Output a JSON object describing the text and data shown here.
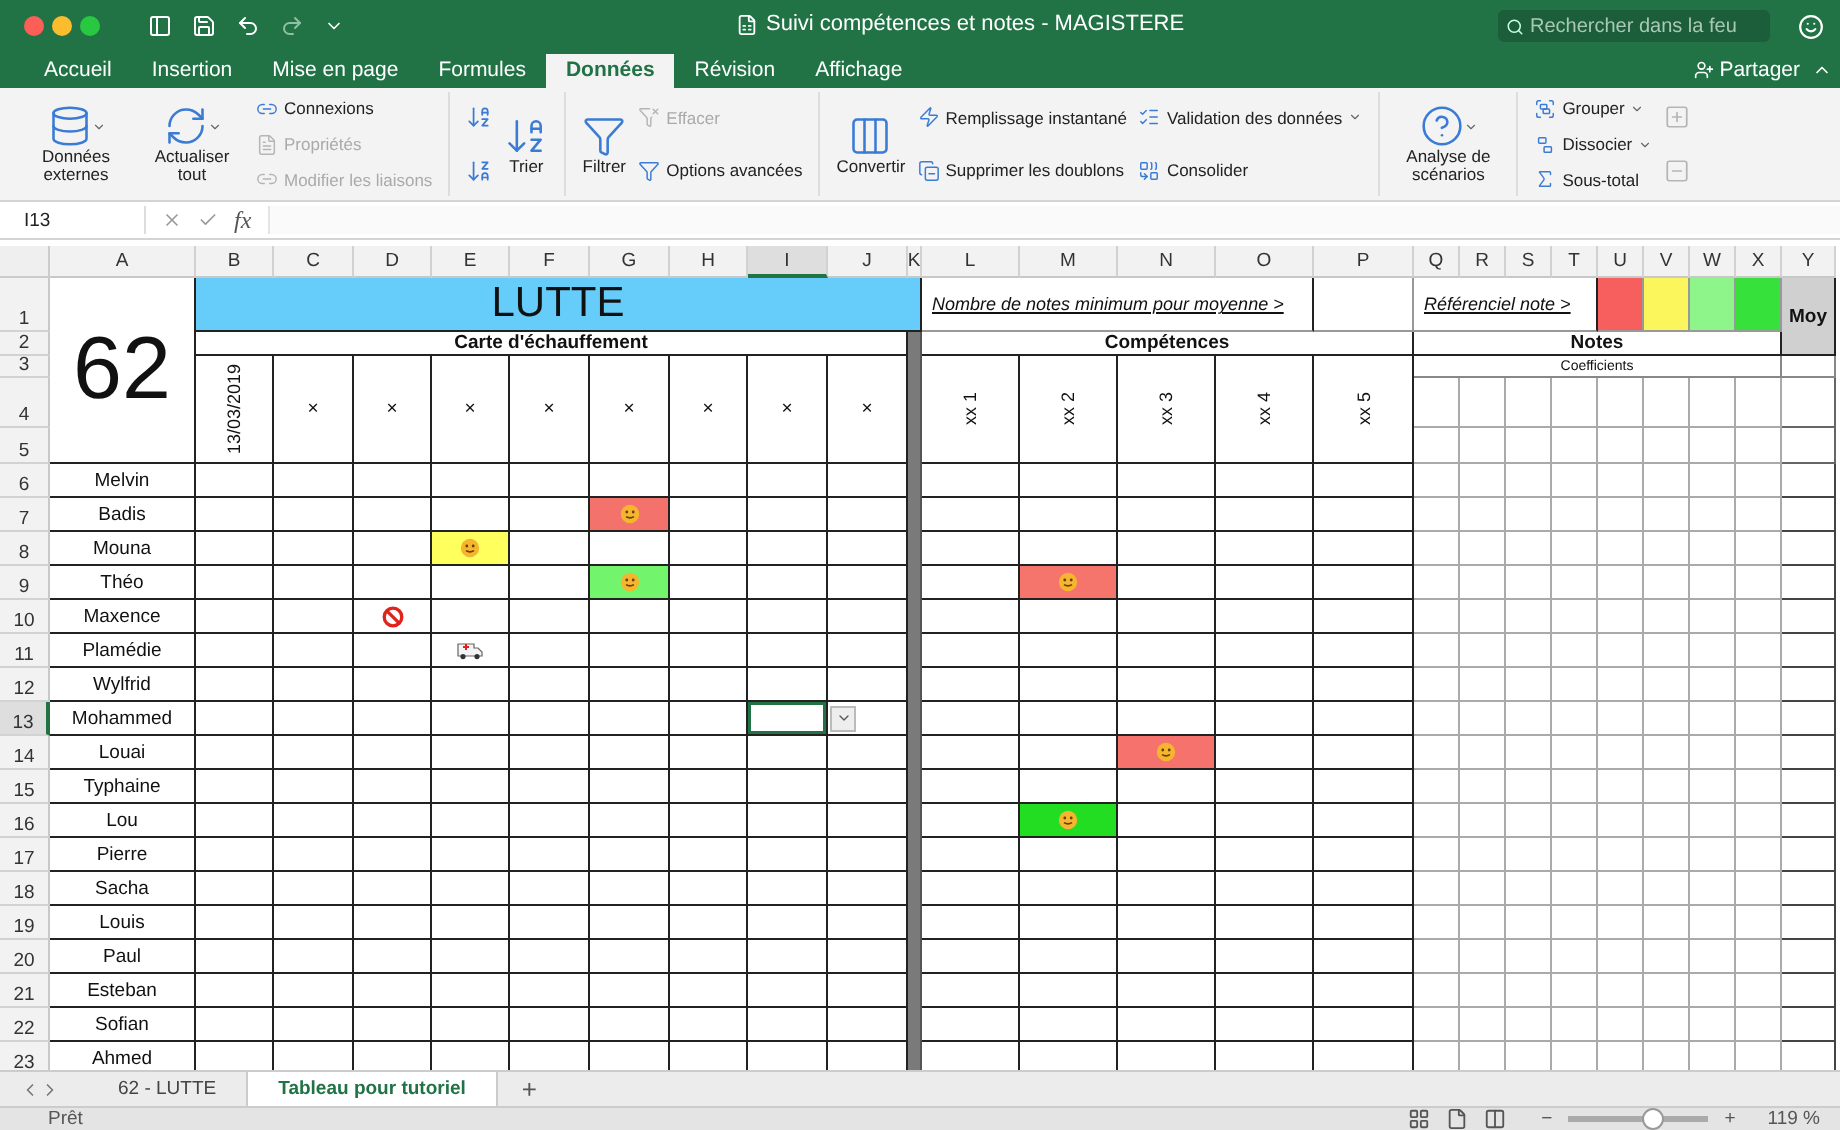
{
  "window": {
    "title": "Suivi compétences et notes - MAGISTERE",
    "search": {
      "placeholder": "Rechercher dans la feu"
    },
    "share": "Partager"
  },
  "tabs": [
    {
      "label": "Accueil",
      "selected": false
    },
    {
      "label": "Insertion",
      "selected": false
    },
    {
      "label": "Mise en page",
      "selected": false
    },
    {
      "label": "Formules",
      "selected": false
    },
    {
      "label": "Données",
      "selected": true
    },
    {
      "label": "Révision",
      "selected": false
    },
    {
      "label": "Affichage",
      "selected": false
    }
  ],
  "ribbon": [
    [
      [
        {
          "kind": "large",
          "label": "Données externes",
          "disabled": false,
          "dropdown": true
        }
      ],
      [
        {
          "kind": "large",
          "label": "Actualiser tout",
          "disabled": false,
          "dropdown": true
        }
      ],
      [
        {
          "kind": "small",
          "label": "Connexions",
          "disabled": false
        },
        {
          "kind": "small",
          "label": "Propriétés",
          "disabled": true
        },
        {
          "kind": "small",
          "label": "Modifier les liaisons",
          "disabled": true
        }
      ]
    ],
    [
      [
        {
          "kind": "icon",
          "disabled": false
        },
        {
          "kind": "icon",
          "disabled": false
        }
      ],
      [
        {
          "kind": "large",
          "label": "Trier",
          "disabled": false
        }
      ]
    ],
    [
      [
        {
          "kind": "large",
          "label": "Filtrer",
          "disabled": false
        }
      ],
      [
        {
          "kind": "small",
          "label": "Effacer",
          "disabled": true
        },
        {
          "kind": "small",
          "label": "Options avancées",
          "disabled": false
        }
      ]
    ],
    [
      [
        {
          "kind": "large",
          "label": "Convertir",
          "disabled": false
        }
      ],
      [
        {
          "kind": "small",
          "label": "Remplissage instantané",
          "disabled": false
        },
        {
          "kind": "small",
          "label": "Supprimer les doublons",
          "disabled": false
        }
      ],
      [
        {
          "kind": "small",
          "label": "Validation des données",
          "disabled": false,
          "dropdown": true
        },
        {
          "kind": "small",
          "label": "Consolider",
          "disabled": false
        }
      ]
    ],
    [
      [
        {
          "kind": "large",
          "label": "Analyse de scénarios",
          "disabled": false,
          "dropdown": true
        }
      ]
    ],
    [
      [
        {
          "kind": "small",
          "label": "Grouper",
          "disabled": false,
          "dropdown": true
        },
        {
          "kind": "small",
          "label": "Dissocier",
          "disabled": false,
          "dropdown": true
        },
        {
          "kind": "small",
          "label": "Sous-total",
          "disabled": false
        }
      ],
      [
        {
          "kind": "icon",
          "disabled": true
        },
        {
          "kind": "icon",
          "disabled": true
        }
      ]
    ]
  ],
  "formula_bar": {
    "cell": "I13",
    "fx": "fx"
  },
  "columns": [
    {
      "label": "A",
      "selected": false
    },
    {
      "label": "B",
      "selected": false
    },
    {
      "label": "C",
      "selected": false
    },
    {
      "label": "D",
      "selected": false
    },
    {
      "label": "E",
      "selected": false
    },
    {
      "label": "F",
      "selected": false
    },
    {
      "label": "G",
      "selected": false
    },
    {
      "label": "H",
      "selected": false
    },
    {
      "label": "I",
      "selected": true
    },
    {
      "label": "J",
      "selected": false
    },
    {
      "label": "K",
      "selected": false
    },
    {
      "label": "L",
      "selected": false
    },
    {
      "label": "M",
      "selected": false
    },
    {
      "label": "N",
      "selected": false
    },
    {
      "label": "O",
      "selected": false
    },
    {
      "label": "P",
      "selected": false
    },
    {
      "label": "Q",
      "selected": false
    },
    {
      "label": "R",
      "selected": false
    },
    {
      "label": "S",
      "selected": false
    },
    {
      "label": "T",
      "selected": false
    },
    {
      "label": "U",
      "selected": false
    },
    {
      "label": "V",
      "selected": false
    },
    {
      "label": "W",
      "selected": false
    },
    {
      "label": "X",
      "selected": false
    },
    {
      "label": "Y",
      "selected": false
    }
  ],
  "row_numbers": [
    {
      "label": "1",
      "selected": false
    },
    {
      "label": "2",
      "selected": false
    },
    {
      "label": "3",
      "selected": false
    },
    {
      "label": "4",
      "selected": false
    },
    {
      "label": "5",
      "selected": false
    },
    {
      "label": "6",
      "selected": false
    },
    {
      "label": "7",
      "selected": false
    },
    {
      "label": "8",
      "selected": false
    },
    {
      "label": "9",
      "selected": false
    },
    {
      "label": "10",
      "selected": false
    },
    {
      "label": "11",
      "selected": false
    },
    {
      "label": "12",
      "selected": false
    },
    {
      "label": "13",
      "selected": true
    },
    {
      "label": "14",
      "selected": false
    },
    {
      "label": "15",
      "selected": false
    },
    {
      "label": "16",
      "selected": false
    },
    {
      "label": "17",
      "selected": false
    },
    {
      "label": "18",
      "selected": false
    },
    {
      "label": "19",
      "selected": false
    },
    {
      "label": "20",
      "selected": false
    },
    {
      "label": "21",
      "selected": false
    },
    {
      "label": "22",
      "selected": false
    },
    {
      "label": "23",
      "selected": false
    }
  ],
  "sheet": {
    "number": "62",
    "title": "LUTTE",
    "min_notes_label": "Nombre de notes minimum pour moyenne >",
    "reference_label": "Référenciel note >",
    "reference_colors": [
      {
        "color": "#f75f5f"
      },
      {
        "color": "#fbf65c"
      },
      {
        "color": "#8ef58a"
      },
      {
        "color": "#35e13a"
      }
    ],
    "average": "Moy",
    "warmup_title": "Carte d'échauffement",
    "date": "13/03/2019",
    "warmup_columns": [
      "×",
      "×",
      "×",
      "×",
      "×",
      "×",
      "×",
      "×"
    ],
    "competences_title": "Compétences",
    "competences": [
      "xx 1",
      "xx 2",
      "xx 3",
      "xx 4",
      "xx 5"
    ],
    "notes_title": "Notes",
    "coefficients": "Coefficients"
  },
  "students": [
    {
      "name": "Melvin"
    },
    {
      "name": "Badis",
      "warmup": [
        {
          "kind": "blank",
          "selected": false
        },
        {
          "kind": "blank",
          "selected": false
        },
        {
          "kind": "blank",
          "selected": false
        },
        {
          "kind": "blank",
          "selected": false
        },
        {
          "kind": "blank",
          "selected": false
        },
        {
          "kind": "smiley",
          "color": "#f4726c",
          "selected": false
        },
        {
          "kind": "blank",
          "selected": false
        },
        {
          "kind": "blank",
          "selected": false
        },
        {
          "kind": "blank",
          "selected": false
        }
      ]
    },
    {
      "name": "Mouna",
      "warmup": [
        {
          "kind": "blank",
          "selected": false
        },
        {
          "kind": "blank",
          "selected": false
        },
        {
          "kind": "blank",
          "selected": false
        },
        {
          "kind": "smiley",
          "color": "#ffff5e",
          "selected": false
        },
        {
          "kind": "blank",
          "selected": false
        },
        {
          "kind": "blank",
          "selected": false
        },
        {
          "kind": "blank",
          "selected": false
        },
        {
          "kind": "blank",
          "selected": false
        },
        {
          "kind": "blank",
          "selected": false
        }
      ]
    },
    {
      "name": "Théo",
      "warmup": [
        {
          "kind": "blank",
          "selected": false
        },
        {
          "kind": "blank",
          "selected": false
        },
        {
          "kind": "blank",
          "selected": false
        },
        {
          "kind": "blank",
          "selected": false
        },
        {
          "kind": "blank",
          "selected": false
        },
        {
          "kind": "smiley",
          "color": "#72f56c",
          "selected": false
        },
        {
          "kind": "blank",
          "selected": false
        },
        {
          "kind": "blank",
          "selected": false
        },
        {
          "kind": "blank",
          "selected": false
        }
      ],
      "competences": [
        {
          "kind": "blank",
          "selected": false
        },
        {
          "kind": "smiley",
          "color": "#f5756c",
          "selected": false
        },
        {
          "kind": "blank",
          "selected": false
        },
        {
          "kind": "blank",
          "selected": false
        },
        {
          "kind": "blank",
          "selected": false
        }
      ]
    },
    {
      "name": "Maxence",
      "warmup": [
        {
          "kind": "blank",
          "selected": false
        },
        {
          "kind": "blank",
          "selected": false
        },
        {
          "kind": "prohibited",
          "selected": false
        },
        {
          "kind": "blank",
          "selected": false
        },
        {
          "kind": "blank",
          "selected": false
        },
        {
          "kind": "blank",
          "selected": false
        },
        {
          "kind": "blank",
          "selected": false
        },
        {
          "kind": "blank",
          "selected": false
        },
        {
          "kind": "blank",
          "selected": false
        }
      ]
    },
    {
      "name": "Plamédie",
      "warmup": [
        {
          "kind": "blank",
          "selected": false
        },
        {
          "kind": "blank",
          "selected": false
        },
        {
          "kind": "blank",
          "selected": false
        },
        {
          "kind": "ambulance",
          "selected": false
        },
        {
          "kind": "blank",
          "selected": false
        },
        {
          "kind": "blank",
          "selected": false
        },
        {
          "kind": "blank",
          "selected": false
        },
        {
          "kind": "blank",
          "selected": false
        },
        {
          "kind": "blank",
          "selected": false
        }
      ]
    },
    {
      "name": "Wylfrid"
    },
    {
      "name": "Mohammed",
      "warmup": [
        {
          "kind": "blank",
          "selected": false
        },
        {
          "kind": "blank",
          "selected": false
        },
        {
          "kind": "blank",
          "selected": false
        },
        {
          "kind": "blank",
          "selected": false
        },
        {
          "kind": "blank",
          "selected": false
        },
        {
          "kind": "blank",
          "selected": false
        },
        {
          "kind": "blank",
          "selected": false
        },
        {
          "kind": "blank",
          "selected": true
        },
        {
          "kind": "blank",
          "selected": false
        }
      ]
    },
    {
      "name": "Louai",
      "competences": [
        {
          "kind": "blank",
          "selected": false
        },
        {
          "kind": "blank",
          "selected": false
        },
        {
          "kind": "smiley",
          "color": "#f5736c",
          "selected": false
        },
        {
          "kind": "blank",
          "selected": false
        },
        {
          "kind": "blank",
          "selected": false
        }
      ]
    },
    {
      "name": "Typhaine"
    },
    {
      "name": "Lou",
      "competences": [
        {
          "kind": "blank",
          "selected": false
        },
        {
          "kind": "smiley",
          "color": "#22dd22",
          "selected": false
        },
        {
          "kind": "blank",
          "selected": false
        },
        {
          "kind": "blank",
          "selected": false
        },
        {
          "kind": "blank",
          "selected": false
        }
      ]
    },
    {
      "name": "Pierre"
    },
    {
      "name": "Sacha"
    },
    {
      "name": "Louis"
    },
    {
      "name": "Paul"
    },
    {
      "name": "Esteban"
    },
    {
      "name": "Sofian"
    },
    {
      "name": "Ahmed"
    }
  ],
  "sheet_tabs": [
    {
      "label": "62 - LUTTE",
      "selected": false
    },
    {
      "label": "Tableau pour tutoriel",
      "selected": true
    }
  ],
  "add_sheet": "+",
  "status_bar": {
    "status": "Prêt",
    "zoom_out": "−",
    "zoom_in": "+",
    "zoom_slider": {
      "level": 0.6
    },
    "zoom": "119 %"
  }
}
